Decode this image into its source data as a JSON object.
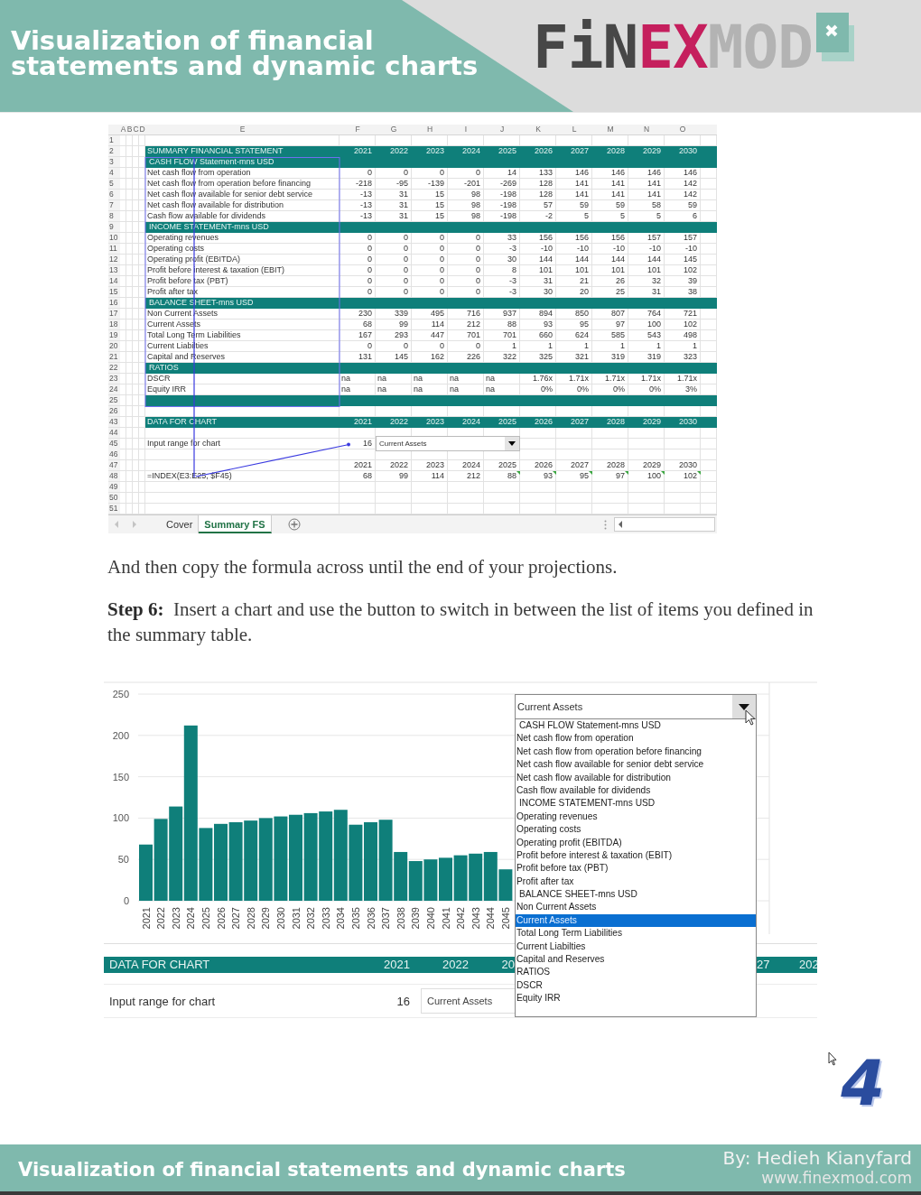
{
  "header": {
    "title_lines": [
      "Visualization of financial",
      "statements and dynamic charts"
    ],
    "logo": [
      {
        "text": "FiN",
        "color": "#474747"
      },
      {
        "text": "EX",
        "color": "#c51f5d"
      },
      {
        "text": "MOD",
        "color": "#b3b3b3"
      }
    ]
  },
  "sheet": {
    "column_headers": [
      "A",
      "B",
      "C",
      "D",
      "E",
      "F",
      "G",
      "H",
      "I",
      "J",
      "K",
      "L",
      "M",
      "N",
      "O"
    ],
    "rows": [
      {
        "number": "1",
        "kind": "blank"
      },
      {
        "number": "2",
        "kind": "title",
        "label": "SUMMARY FINANCIAL STATEMENT",
        "values": [
          "2021",
          "2022",
          "2023",
          "2024",
          "2025",
          "2026",
          "2027",
          "2028",
          "2029",
          "2030"
        ]
      },
      {
        "number": "3",
        "kind": "section",
        "label": "CASH FLOW Statement-mns USD"
      },
      {
        "number": "4",
        "kind": "data",
        "label": "Net cash flow from operation",
        "values": [
          "0",
          "0",
          "0",
          "0",
          "14",
          "133",
          "146",
          "146",
          "146",
          "146"
        ]
      },
      {
        "number": "5",
        "kind": "data",
        "label": "Net cash flow from operation before financing",
        "values": [
          "-218",
          "-95",
          "-139",
          "-201",
          "-269",
          "128",
          "141",
          "141",
          "141",
          "142"
        ]
      },
      {
        "number": "6",
        "kind": "data",
        "label": "Net cash flow available for senior debt service",
        "values": [
          "-13",
          "31",
          "15",
          "98",
          "-198",
          "128",
          "141",
          "141",
          "141",
          "142"
        ]
      },
      {
        "number": "7",
        "kind": "data",
        "label": "Net cash flow available for distribution",
        "values": [
          "-13",
          "31",
          "15",
          "98",
          "-198",
          "57",
          "59",
          "59",
          "58",
          "59"
        ]
      },
      {
        "number": "8",
        "kind": "data",
        "label": "Cash flow available for dividends",
        "values": [
          "-13",
          "31",
          "15",
          "98",
          "-198",
          "-2",
          "5",
          "5",
          "5",
          "6"
        ]
      },
      {
        "number": "9",
        "kind": "section",
        "label": "INCOME STATEMENT-mns USD"
      },
      {
        "number": "10",
        "kind": "data",
        "label": "Operating revenues",
        "values": [
          "0",
          "0",
          "0",
          "0",
          "33",
          "156",
          "156",
          "156",
          "157",
          "157"
        ]
      },
      {
        "number": "11",
        "kind": "data",
        "label": "Operating costs",
        "values": [
          "0",
          "0",
          "0",
          "0",
          "-3",
          "-10",
          "-10",
          "-10",
          "-10",
          "-10"
        ]
      },
      {
        "number": "12",
        "kind": "data",
        "label": "Operating profit (EBITDA)",
        "values": [
          "0",
          "0",
          "0",
          "0",
          "30",
          "144",
          "144",
          "144",
          "144",
          "145"
        ]
      },
      {
        "number": "13",
        "kind": "data",
        "label": "Profit before interest & taxation (EBIT)",
        "values": [
          "0",
          "0",
          "0",
          "0",
          "8",
          "101",
          "101",
          "101",
          "101",
          "102"
        ]
      },
      {
        "number": "14",
        "kind": "data",
        "label": "Profit before tax (PBT)",
        "values": [
          "0",
          "0",
          "0",
          "0",
          "-3",
          "31",
          "21",
          "26",
          "32",
          "39"
        ]
      },
      {
        "number": "15",
        "kind": "data",
        "label": "Profit after tax",
        "values": [
          "0",
          "0",
          "0",
          "0",
          "-3",
          "30",
          "20",
          "25",
          "31",
          "38"
        ]
      },
      {
        "number": "16",
        "kind": "section",
        "label": "BALANCE SHEET-mns USD"
      },
      {
        "number": "17",
        "kind": "data",
        "label": "Non Current Assets",
        "values": [
          "230",
          "339",
          "495",
          "716",
          "937",
          "894",
          "850",
          "807",
          "764",
          "721"
        ]
      },
      {
        "number": "18",
        "kind": "data",
        "label": "Current Assets",
        "values": [
          "68",
          "99",
          "114",
          "212",
          "88",
          "93",
          "95",
          "97",
          "100",
          "102"
        ]
      },
      {
        "number": "19",
        "kind": "data",
        "label": "Total Long Term Liabilities",
        "values": [
          "167",
          "293",
          "447",
          "701",
          "701",
          "660",
          "624",
          "585",
          "543",
          "498"
        ]
      },
      {
        "number": "20",
        "kind": "data",
        "label": "Current Liabilties",
        "values": [
          "0",
          "0",
          "0",
          "0",
          "1",
          "1",
          "1",
          "1",
          "1",
          "1"
        ]
      },
      {
        "number": "21",
        "kind": "data",
        "label": "Capital and Reserves",
        "values": [
          "131",
          "145",
          "162",
          "226",
          "322",
          "325",
          "321",
          "319",
          "319",
          "323"
        ]
      },
      {
        "number": "22",
        "kind": "section",
        "label": "RATIOS"
      },
      {
        "number": "23",
        "kind": "ratio",
        "label": "DSCR",
        "cells": [
          {
            "value": "na",
            "left": true
          },
          {
            "value": "na",
            "left": true
          },
          {
            "value": "na",
            "left": true
          },
          {
            "value": "na",
            "left": true
          },
          {
            "value": "na",
            "left": true
          },
          {
            "value": "1.76x",
            "left": false
          },
          {
            "value": "1.71x",
            "left": false
          },
          {
            "value": "1.71x",
            "left": false
          },
          {
            "value": "1.71x",
            "left": false
          },
          {
            "value": "1.71x",
            "left": false
          }
        ]
      },
      {
        "number": "24",
        "kind": "ratio",
        "label": "Equity IRR",
        "cells": [
          {
            "value": "na",
            "left": true
          },
          {
            "value": "na",
            "left": true
          },
          {
            "value": "na",
            "left": true
          },
          {
            "value": "na",
            "left": true
          },
          {
            "value": "na",
            "left": true
          },
          {
            "value": "0%",
            "left": false
          },
          {
            "value": "0%",
            "left": false
          },
          {
            "value": "0%",
            "left": false
          },
          {
            "value": "0%",
            "left": false
          },
          {
            "value": "3%",
            "left": false
          }
        ]
      },
      {
        "number": "25",
        "kind": "band"
      },
      {
        "number": "26",
        "kind": "blank"
      },
      {
        "number": "43",
        "kind": "title",
        "label": "DATA FOR CHART",
        "values": [
          "2021",
          "2022",
          "2023",
          "2024",
          "2025",
          "2026",
          "2027",
          "2028",
          "2029",
          "2030"
        ]
      },
      {
        "number": "44",
        "kind": "blank"
      },
      {
        "number": "45",
        "kind": "input",
        "label": "Input range for chart",
        "index": "16",
        "combo_value": "Current Assets"
      },
      {
        "number": "46",
        "kind": "blank"
      },
      {
        "number": "47",
        "kind": "data",
        "values": [
          "2021",
          "2022",
          "2023",
          "2024",
          "2025",
          "2026",
          "2027",
          "2028",
          "2029",
          "2030"
        ]
      },
      {
        "number": "48",
        "kind": "formula",
        "label": "=INDEX(E3:E25, $F45)",
        "values": [
          "68",
          "99",
          "114",
          "212",
          "88",
          "93",
          "95",
          "97",
          "100",
          "102"
        ],
        "error_marks": [
          false,
          false,
          false,
          false,
          true,
          true,
          true,
          true,
          true,
          true
        ]
      },
      {
        "number": "49",
        "kind": "blank"
      },
      {
        "number": "50",
        "kind": "blank"
      },
      {
        "number": "51",
        "kind": "blank"
      }
    ],
    "tabs": [
      {
        "label": "Cover",
        "selected": false
      },
      {
        "label": "Summary FS",
        "selected": true
      }
    ]
  },
  "paragraphs": [
    "And then copy the formula across until the end of your projections.",
    "**Step 6:**  Insert a chart and use the button to switch in between the list of items you defined in the summary table."
  ],
  "chart": {
    "chart_data": {
      "type": "bar",
      "categories": [
        "2021",
        "2022",
        "2023",
        "2024",
        "2025",
        "2026",
        "2027",
        "2028",
        "2029",
        "2030",
        "2031",
        "2032",
        "2033",
        "2034",
        "2035",
        "2036",
        "2037",
        "2038",
        "2039",
        "2040",
        "2041",
        "2042",
        "2043",
        "2044",
        "2045"
      ],
      "series": [
        {
          "color": "#0f7f7a",
          "values": [
            68,
            99,
            114,
            212,
            88,
            93,
            95,
            97,
            100,
            102,
            104,
            106,
            108,
            110,
            92,
            95,
            98,
            59,
            48,
            50,
            52,
            55,
            57,
            59,
            38
          ]
        }
      ],
      "ylim": [
        0,
        250
      ],
      "yticks": [
        0,
        50,
        100,
        150,
        200,
        250
      ],
      "grid": true
    },
    "table": {
      "title": "DATA FOR CHART",
      "years": [
        "2021",
        "2022",
        "20",
        "27",
        "202"
      ],
      "input_label": "Input range for chart",
      "index": "16",
      "combo_value": "Current Assets"
    },
    "dropdown": {
      "value": "Current Assets",
      "options": [
        {
          "label": "CASH FLOW Statement-mns USD",
          "kind": "heading",
          "selected": false
        },
        {
          "label": "Net cash flow from operation",
          "kind": "item",
          "selected": false
        },
        {
          "label": "Net cash flow from operation before financing",
          "kind": "item",
          "selected": false
        },
        {
          "label": "Net cash flow available for senior debt service",
          "kind": "item",
          "selected": false
        },
        {
          "label": "Net cash flow available for distribution",
          "kind": "item",
          "selected": false
        },
        {
          "label": "Cash flow available for dividends",
          "kind": "item",
          "selected": false
        },
        {
          "label": "INCOME STATEMENT-mns USD",
          "kind": "heading",
          "selected": false
        },
        {
          "label": "Operating revenues",
          "kind": "item",
          "selected": false
        },
        {
          "label": "Operating costs",
          "kind": "item",
          "selected": false
        },
        {
          "label": "Operating profit (EBITDA)",
          "kind": "item",
          "selected": false
        },
        {
          "label": "Profit before interest & taxation (EBIT)",
          "kind": "item",
          "selected": false
        },
        {
          "label": "Profit before tax (PBT)",
          "kind": "item",
          "selected": false
        },
        {
          "label": "Profit after tax",
          "kind": "item",
          "selected": false
        },
        {
          "label": "BALANCE SHEET-mns USD",
          "kind": "heading",
          "selected": false
        },
        {
          "label": "Non Current Assets",
          "kind": "item",
          "selected": false
        },
        {
          "label": "Current Assets",
          "kind": "item",
          "selected": true
        },
        {
          "label": "Total Long Term Liabilities",
          "kind": "item",
          "selected": false
        },
        {
          "label": "Current Liabilties",
          "kind": "item",
          "selected": false
        },
        {
          "label": "Capital and Reserves",
          "kind": "item",
          "selected": false
        },
        {
          "label": "RATIOS",
          "kind": "item",
          "selected": false
        },
        {
          "label": "DSCR",
          "kind": "item",
          "selected": false
        },
        {
          "label": "Equity IRR",
          "kind": "item",
          "selected": false
        }
      ]
    }
  },
  "page_number": "4",
  "footer": {
    "title": "Visualization of financial statements and dynamic charts",
    "author": "By: Hedieh Kianyfard",
    "url": "www.finexmod.com"
  }
}
